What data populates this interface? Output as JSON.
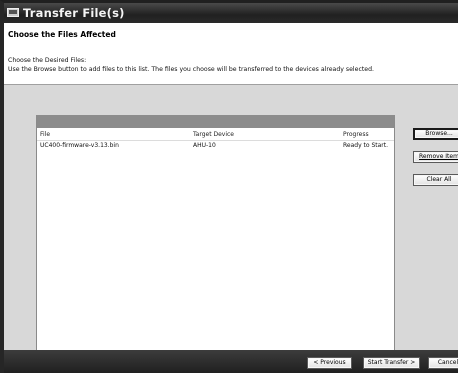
{
  "window": {
    "title": "Transfer File(s)"
  },
  "header": {
    "title": "Choose the Files Affected",
    "line1": "Choose the Desired Files:",
    "line2": "Use the Browse button to add files to this list.  The files you choose will be transferred to the devices already selected."
  },
  "list": {
    "columns": [
      "File",
      "Target Device",
      "Progress"
    ],
    "rows": [
      {
        "file": "UC400-firmware-v3.13.bin",
        "device": "AHU-10",
        "progress": "Ready to Start."
      }
    ]
  },
  "buttons": {
    "browse": "Browse...",
    "remove": "Remove Item",
    "clear": "Clear All",
    "previous": "< Previous",
    "start": "Start Transfer >",
    "cancel": "Cancel"
  }
}
